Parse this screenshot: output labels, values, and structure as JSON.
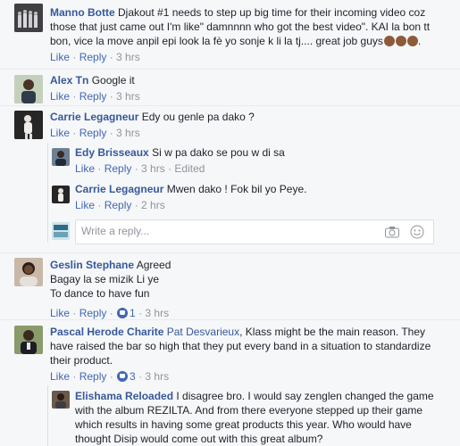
{
  "comments": [
    {
      "name": "Manno Botte",
      "text": "Djakout #1 needs to step up big time for their incoming video coz those that just came out I'm like\" damnnnn who got the best video\". KAI la bon tt bon, vice la move anpil epi look la fè yo sonje k li la tj.... great job guys",
      "text_end": ".",
      "like": "Like",
      "reply": "Reply",
      "time": "3 hrs"
    },
    {
      "name": "Alex Tn",
      "text": "Google it",
      "like": "Like",
      "reply": "Reply",
      "time": "3 hrs"
    },
    {
      "name": "Carrie Legagneur",
      "text": "Edy ou genle pa dako ?",
      "like": "Like",
      "reply": "Reply",
      "time": "3 hrs",
      "replies": [
        {
          "name": "Edy Brisseaux",
          "text": "Si w pa dako se pou w di sa",
          "like": "Like",
          "reply": "Reply",
          "time": "3 hrs",
          "edited": "Edited"
        },
        {
          "name": "Carrie Legagneur",
          "text": "Mwen dako ! Fok bil yo Peye.",
          "like": "Like",
          "reply": "Reply",
          "time": "2 hrs"
        }
      ],
      "reply_placeholder": "Write a reply..."
    },
    {
      "name": "Geslin Stephane",
      "text": "Agreed",
      "lines": [
        "Bagay la se mizik Li ye",
        "To dance to have fun"
      ],
      "like": "Like",
      "reply": "Reply",
      "like_count": "1",
      "time": "3 hrs"
    },
    {
      "name": "Pascal Herode Charite",
      "tag": "Pat Desvarieux",
      "text": ", Klass might be the main reason. They have raised the bar so high that they put every band in a situation to standardize their product.",
      "like": "Like",
      "reply": "Reply",
      "like_count": "3",
      "time": "3 hrs",
      "replies": [
        {
          "name": "Elishama Reloaded",
          "text": "I disagree bro. I would say zenglen changed the game with the album REZILTA. And from there everyone stepped up their game which results in having some great products this year. Who would have thought Disip would come out with this great album?"
        }
      ]
    }
  ],
  "colors": {
    "name": "#365899",
    "link": "#4267b2",
    "meta": "#90949c",
    "bg": "#f6f7f9"
  },
  "icons": [
    "camera-icon",
    "emoji-icon",
    "like-badge-icon"
  ]
}
